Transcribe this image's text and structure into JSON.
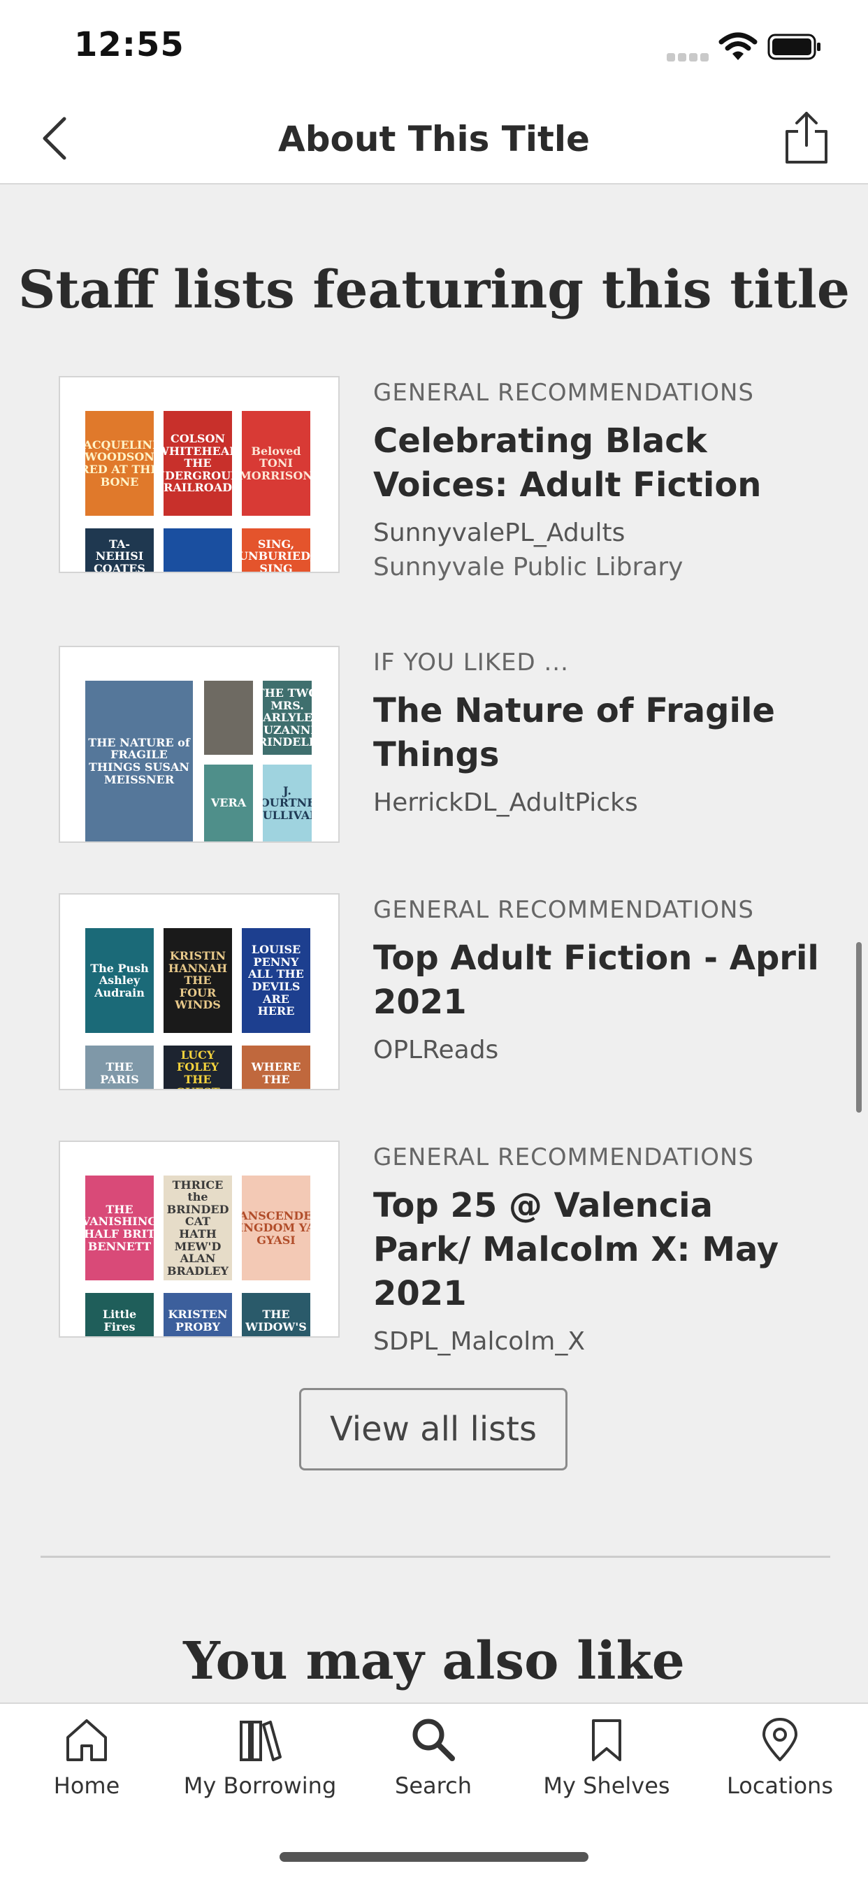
{
  "status_bar": {
    "time": "12:55"
  },
  "nav": {
    "title": "About This Title"
  },
  "staff_lists": {
    "heading": "Staff lists featuring this title",
    "items": [
      {
        "category": "GENERAL RECOMMENDATIONS",
        "title": "Celebrating Black Voices: Adult Fiction",
        "user": "SunnyvalePL_Adults",
        "library": "Sunnyvale Public Library",
        "covers": [
          {
            "text": "JACQUELINE WOODSON RED AT THE BONE",
            "bg": "#e0792b",
            "fg": "#fff3c8"
          },
          {
            "text": "COLSON WHITEHEAD THE UNDERGROUND RAILROAD",
            "bg": "#c8302b",
            "fg": "#ffffff"
          },
          {
            "text": "Beloved TONI MORRISON",
            "bg": "#d83a35",
            "fg": "#fde5d5"
          },
          {
            "text": "TA-NEHISI COATES",
            "bg": "#1f3850",
            "fg": "#ffffff"
          },
          {
            "text": "",
            "bg": "#1a4fa0",
            "fg": "#ffffff"
          },
          {
            "text": "SING, UNBURIED, SING",
            "bg": "#e4542c",
            "fg": "#ffffff"
          }
        ]
      },
      {
        "category": "IF YOU LIKED ...",
        "title": "The Nature of Fragile Things",
        "user": "HerrickDL_AdultPicks",
        "library": "",
        "covers": [
          {
            "text": "THE NATURE of FRAGILE THINGS SUSAN MEISSNER",
            "bg": "#55779a",
            "fg": "#ffffff"
          },
          {
            "text": "",
            "bg": "#6e6a62",
            "fg": "#ffffff"
          },
          {
            "text": "THE TWO MRS. CARLYLES SUZANNE RINDELL",
            "bg": "#3f6f6e",
            "fg": "#ffffff"
          },
          {
            "text": "VERA",
            "bg": "#4f8f8a",
            "fg": "#ffffff"
          },
          {
            "text": "J. COURTNEY SULLIVAN",
            "bg": "#9fd3df",
            "fg": "#1f3a55"
          }
        ]
      },
      {
        "category": "GENERAL RECOMMENDATIONS",
        "title": "Top Adult Fiction - April 2021",
        "user": "OPLReads",
        "library": "",
        "covers": [
          {
            "text": "The Push Ashley Audrain",
            "bg": "#1b6a78",
            "fg": "#ffffff"
          },
          {
            "text": "KRISTIN HANNAH THE FOUR WINDS",
            "bg": "#1a1a1a",
            "fg": "#e8c98a"
          },
          {
            "text": "LOUISE PENNY ALL THE DEVILS ARE HERE",
            "bg": "#1d3f8f",
            "fg": "#ffffff"
          },
          {
            "text": "THE PARIS",
            "bg": "#7f98a8",
            "fg": "#ffffff"
          },
          {
            "text": "LUCY FOLEY THE GUEST",
            "bg": "#1d2430",
            "fg": "#f3d23c"
          },
          {
            "text": "WHERE THE",
            "bg": "#c0683d",
            "fg": "#ffffff"
          }
        ]
      },
      {
        "category": "GENERAL RECOMMENDATIONS",
        "title": "Top 25 @ Valencia Park/ Malcolm X: May 2021",
        "user": "SDPL_Malcolm_X",
        "library": "",
        "covers": [
          {
            "text": "THE VANISHING HALF BRIT BENNETT",
            "bg": "#d94a78",
            "fg": "#ffffff"
          },
          {
            "text": "THRICE the BRINDED CAT HATH MEW'D ALAN BRADLEY",
            "bg": "#e6dcc8",
            "fg": "#3a3a3a"
          },
          {
            "text": "TRANSCENDENT KINGDOM YAA GYASI",
            "bg": "#f3c9b5",
            "fg": "#b14d2a"
          },
          {
            "text": "Little Fires",
            "bg": "#1f5e5a",
            "fg": "#ffffff"
          },
          {
            "text": "KRISTEN PROBY",
            "bg": "#3c5f9c",
            "fg": "#ffffff"
          },
          {
            "text": "THE WIDOW'S",
            "bg": "#2a5a6a",
            "fg": "#ffffff"
          }
        ]
      }
    ],
    "view_all_label": "View all lists"
  },
  "also_like": {
    "heading": "You may also like"
  },
  "tabs": [
    {
      "label": "Home",
      "icon": "home-icon"
    },
    {
      "label": "My Borrowing",
      "icon": "books-icon"
    },
    {
      "label": "Search",
      "icon": "search-icon"
    },
    {
      "label": "My Shelves",
      "icon": "bookmark-icon"
    },
    {
      "label": "Locations",
      "icon": "location-pin-icon"
    }
  ]
}
